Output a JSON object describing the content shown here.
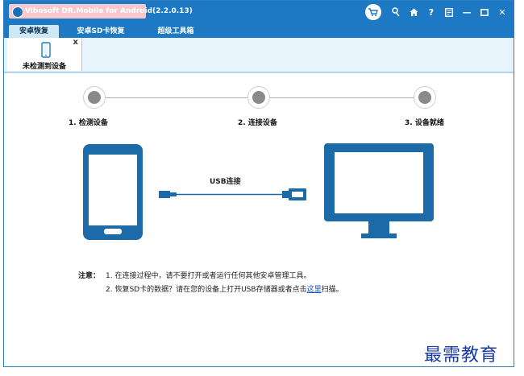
{
  "app": {
    "title": "Vibosoft DR.Mobile for Android(2.2.0.13)"
  },
  "titlebar": {
    "icons": [
      "cart-icon",
      "key-icon",
      "home-icon",
      "help-icon",
      "register-icon",
      "minimize-icon",
      "maximize-icon",
      "close-icon"
    ],
    "help_glyph": "?",
    "minimize_glyph": "—",
    "close_glyph": "✕"
  },
  "tabs": [
    {
      "label": "安卓恢复",
      "active": true
    },
    {
      "label": "安卓SD卡恢复",
      "active": false
    },
    {
      "label": "超级工具箱",
      "active": false
    }
  ],
  "device": {
    "close_glyph": "x",
    "label": "未检测到设备"
  },
  "steps": [
    {
      "label": "1. 检测设备"
    },
    {
      "label": "2. 连接设备"
    },
    {
      "label": "3. 设备就绪"
    }
  ],
  "illustration": {
    "usb_label": "USB连接"
  },
  "notes": {
    "title": "注意：",
    "line1": "1. 在连接过程中，请不要打开或者运行任何其他安卓管理工具。",
    "line2_prefix": "2. 恢复SD卡的数据？请在您的设备上打开USB存储器或者点击",
    "line2_link": "这里",
    "line2_suffix": "扫描。"
  },
  "watermark": "最需教育",
  "colors": {
    "titlebar": "#1d79c4",
    "accent": "#1d6aa8",
    "active_tab": "#cfe8f8",
    "step_dot": "#8a8a8a"
  }
}
